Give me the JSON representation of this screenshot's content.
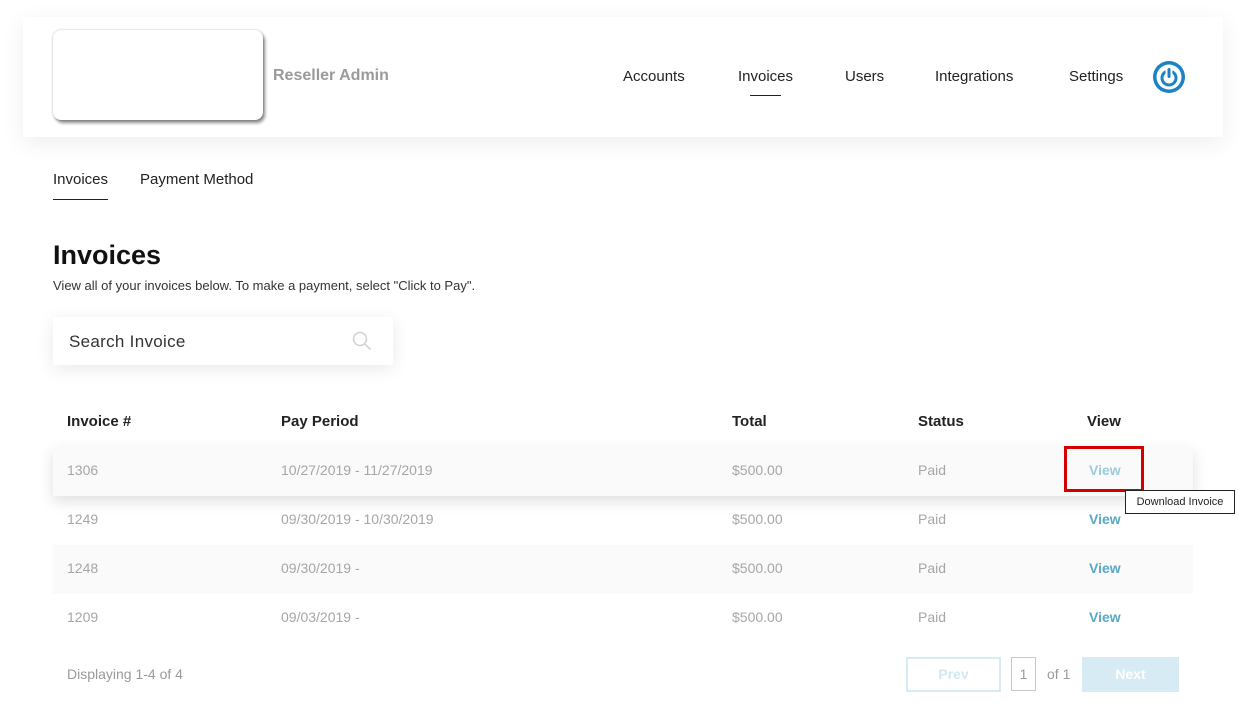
{
  "header": {
    "brand": "Reseller Admin",
    "nav": [
      {
        "label": "Accounts"
      },
      {
        "label": "Invoices"
      },
      {
        "label": "Users"
      },
      {
        "label": "Integrations"
      },
      {
        "label": "Settings"
      }
    ],
    "active_nav": "Invoices",
    "power_icon": "power-icon",
    "accent_color": "#1d82c4"
  },
  "subtabs": [
    {
      "label": "Invoices"
    },
    {
      "label": "Payment Method"
    }
  ],
  "page": {
    "title": "Invoices",
    "subtitle": "View all of your invoices below. To make a payment, select \"Click to Pay\"."
  },
  "search": {
    "placeholder": "Search Invoice",
    "value": "",
    "icon": "search-icon"
  },
  "table": {
    "columns": [
      "Invoice #",
      "Pay Period",
      "Total",
      "Status",
      "View"
    ],
    "rows": [
      {
        "invoice": "1306",
        "period": "10/27/2019 - 11/27/2019",
        "total": "$500.00",
        "status": "Paid",
        "view": "View"
      },
      {
        "invoice": "1249",
        "period": "09/30/2019 - 10/30/2019",
        "total": "$500.00",
        "status": "Paid",
        "view": "View"
      },
      {
        "invoice": "1248",
        "period": "09/30/2019 -",
        "total": "$500.00",
        "status": "Paid",
        "view": "View"
      },
      {
        "invoice": "1209",
        "period": "09/03/2019 -",
        "total": "$500.00",
        "status": "Paid",
        "view": "View"
      }
    ]
  },
  "tooltip": "Download Invoice",
  "pagination": {
    "display_text": "Displaying 1-4 of 4",
    "prev": "Prev",
    "page": "1",
    "of": "of 1",
    "next": "Next"
  },
  "colors": {
    "link": "#5aa7c6",
    "highlight_border": "#d40000",
    "disabled_button": "#d6ebf3"
  }
}
